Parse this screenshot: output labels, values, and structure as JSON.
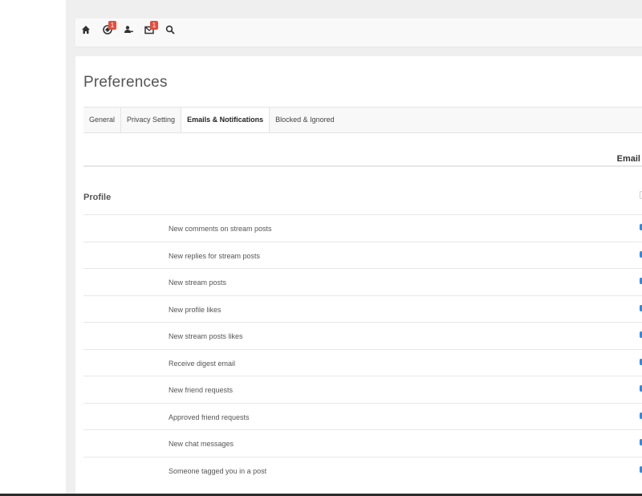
{
  "toolbar": {
    "icons": [
      {
        "name": "home-icon"
      },
      {
        "name": "notifications-icon",
        "badge": "1"
      },
      {
        "name": "friends-icon"
      },
      {
        "name": "messages-icon",
        "badge": "1"
      },
      {
        "name": "search-icon"
      }
    ]
  },
  "page": {
    "title": "Preferences"
  },
  "tabs": [
    {
      "label": "General"
    },
    {
      "label": "Privacy Setting"
    },
    {
      "label": "Emails & Notifications",
      "active": true
    },
    {
      "label": "Blocked & Ignored"
    }
  ],
  "table": {
    "column_header": "Email",
    "section": "Profile",
    "rows": [
      {
        "label": "New comments on stream posts",
        "checked": true
      },
      {
        "label": "New replies for stream posts",
        "checked": true
      },
      {
        "label": "New stream posts",
        "checked": true
      },
      {
        "label": "New profile likes",
        "checked": true
      },
      {
        "label": "New stream posts likes",
        "checked": true
      },
      {
        "label": "Receive digest email",
        "checked": true
      },
      {
        "label": "New friend requests",
        "checked": true
      },
      {
        "label": "Approved friend requests",
        "checked": true
      },
      {
        "label": "New chat messages",
        "checked": true
      },
      {
        "label": "Someone tagged you in a post",
        "checked": true
      }
    ]
  },
  "colors": {
    "checkbox_accent": "#2d8ae6",
    "badge": "#e74c3c"
  }
}
